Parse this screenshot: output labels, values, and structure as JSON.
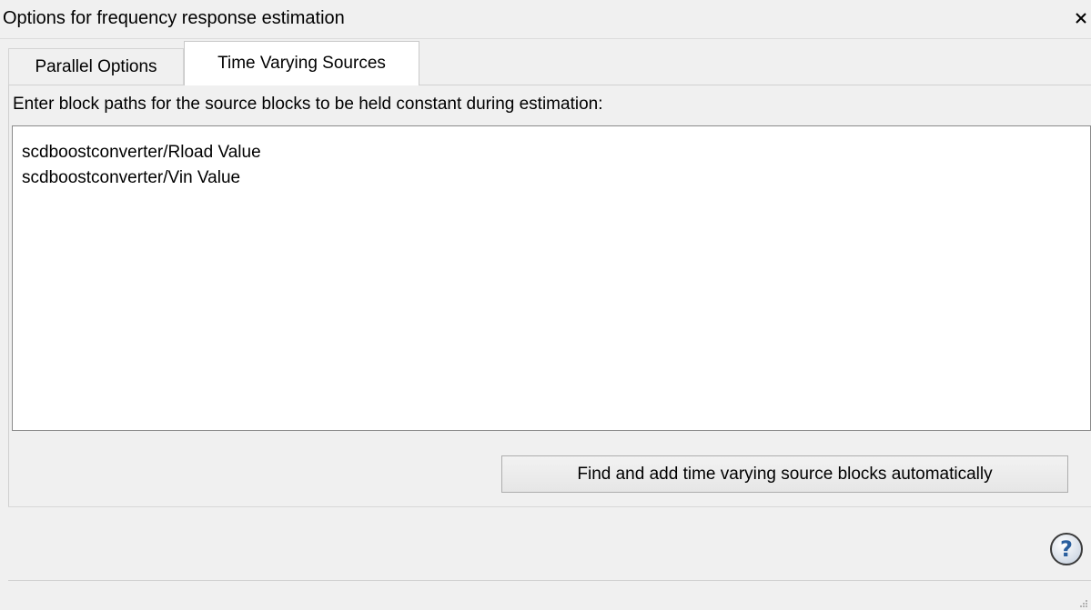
{
  "window": {
    "title": "Options for frequency response estimation",
    "close_glyph": "×"
  },
  "tabs": [
    {
      "label": "Parallel Options",
      "active": false
    },
    {
      "label": "Time Varying Sources",
      "active": true
    }
  ],
  "time_varying_sources": {
    "instruction": "Enter block paths for the source blocks to be held constant during estimation:",
    "block_paths": [
      "scdboostconverter/Rload Value",
      "scdboostconverter/Vin Value"
    ],
    "find_button_label": "Find and add time varying source blocks automatically"
  },
  "help": {
    "icon": "question-mark-circle-icon",
    "glyph": "?"
  },
  "colors": {
    "window_bg": "#f0f0f0",
    "text_area_bg": "#ffffff",
    "help_icon_blue": "#2a5f9e"
  }
}
